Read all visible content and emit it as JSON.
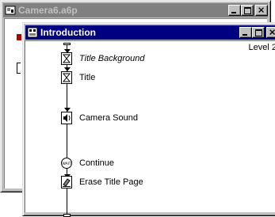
{
  "background_window": {
    "title": "Camera6.a6p",
    "icon": "authorware-file-icon",
    "buttons": [
      "minimize",
      "maximize",
      "close"
    ]
  },
  "front_window": {
    "title": "Introduction",
    "icon": "map-icon",
    "level_label": "Level 2",
    "buttons": [
      "minimize",
      "maximize",
      "close"
    ]
  },
  "flowline": {
    "icons": [
      {
        "label": "Title Background",
        "italic": true,
        "icon": "display-icon"
      },
      {
        "label": "Title",
        "italic": false,
        "icon": "display-icon"
      },
      {
        "label": "Camera Sound",
        "italic": false,
        "icon": "sound-icon"
      },
      {
        "label": "Continue",
        "italic": false,
        "icon": "wait-icon"
      },
      {
        "label": "Erase Title Page",
        "italic": false,
        "icon": "erase-icon"
      }
    ]
  },
  "colors": {
    "active_title": "#000080",
    "inactive_title": "#808080",
    "face": "#c0c0c0"
  }
}
